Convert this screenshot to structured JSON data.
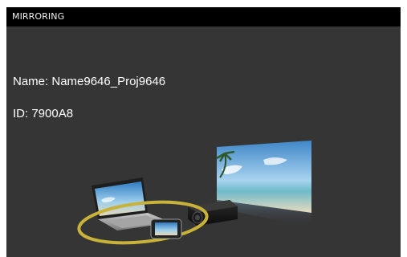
{
  "titlebar": {
    "title": "MIRRORING"
  },
  "info": {
    "name_label": "Name:",
    "name_value": "Name9646_Proj9646",
    "id_label": "ID:",
    "id_value": "7900A8"
  },
  "illustration": {
    "description_icon": "mirroring-illustration-icon"
  },
  "colors": {
    "background": "#353535",
    "titlebar": "#000000",
    "text": "#ffffff",
    "ring": "#c9b23a"
  }
}
